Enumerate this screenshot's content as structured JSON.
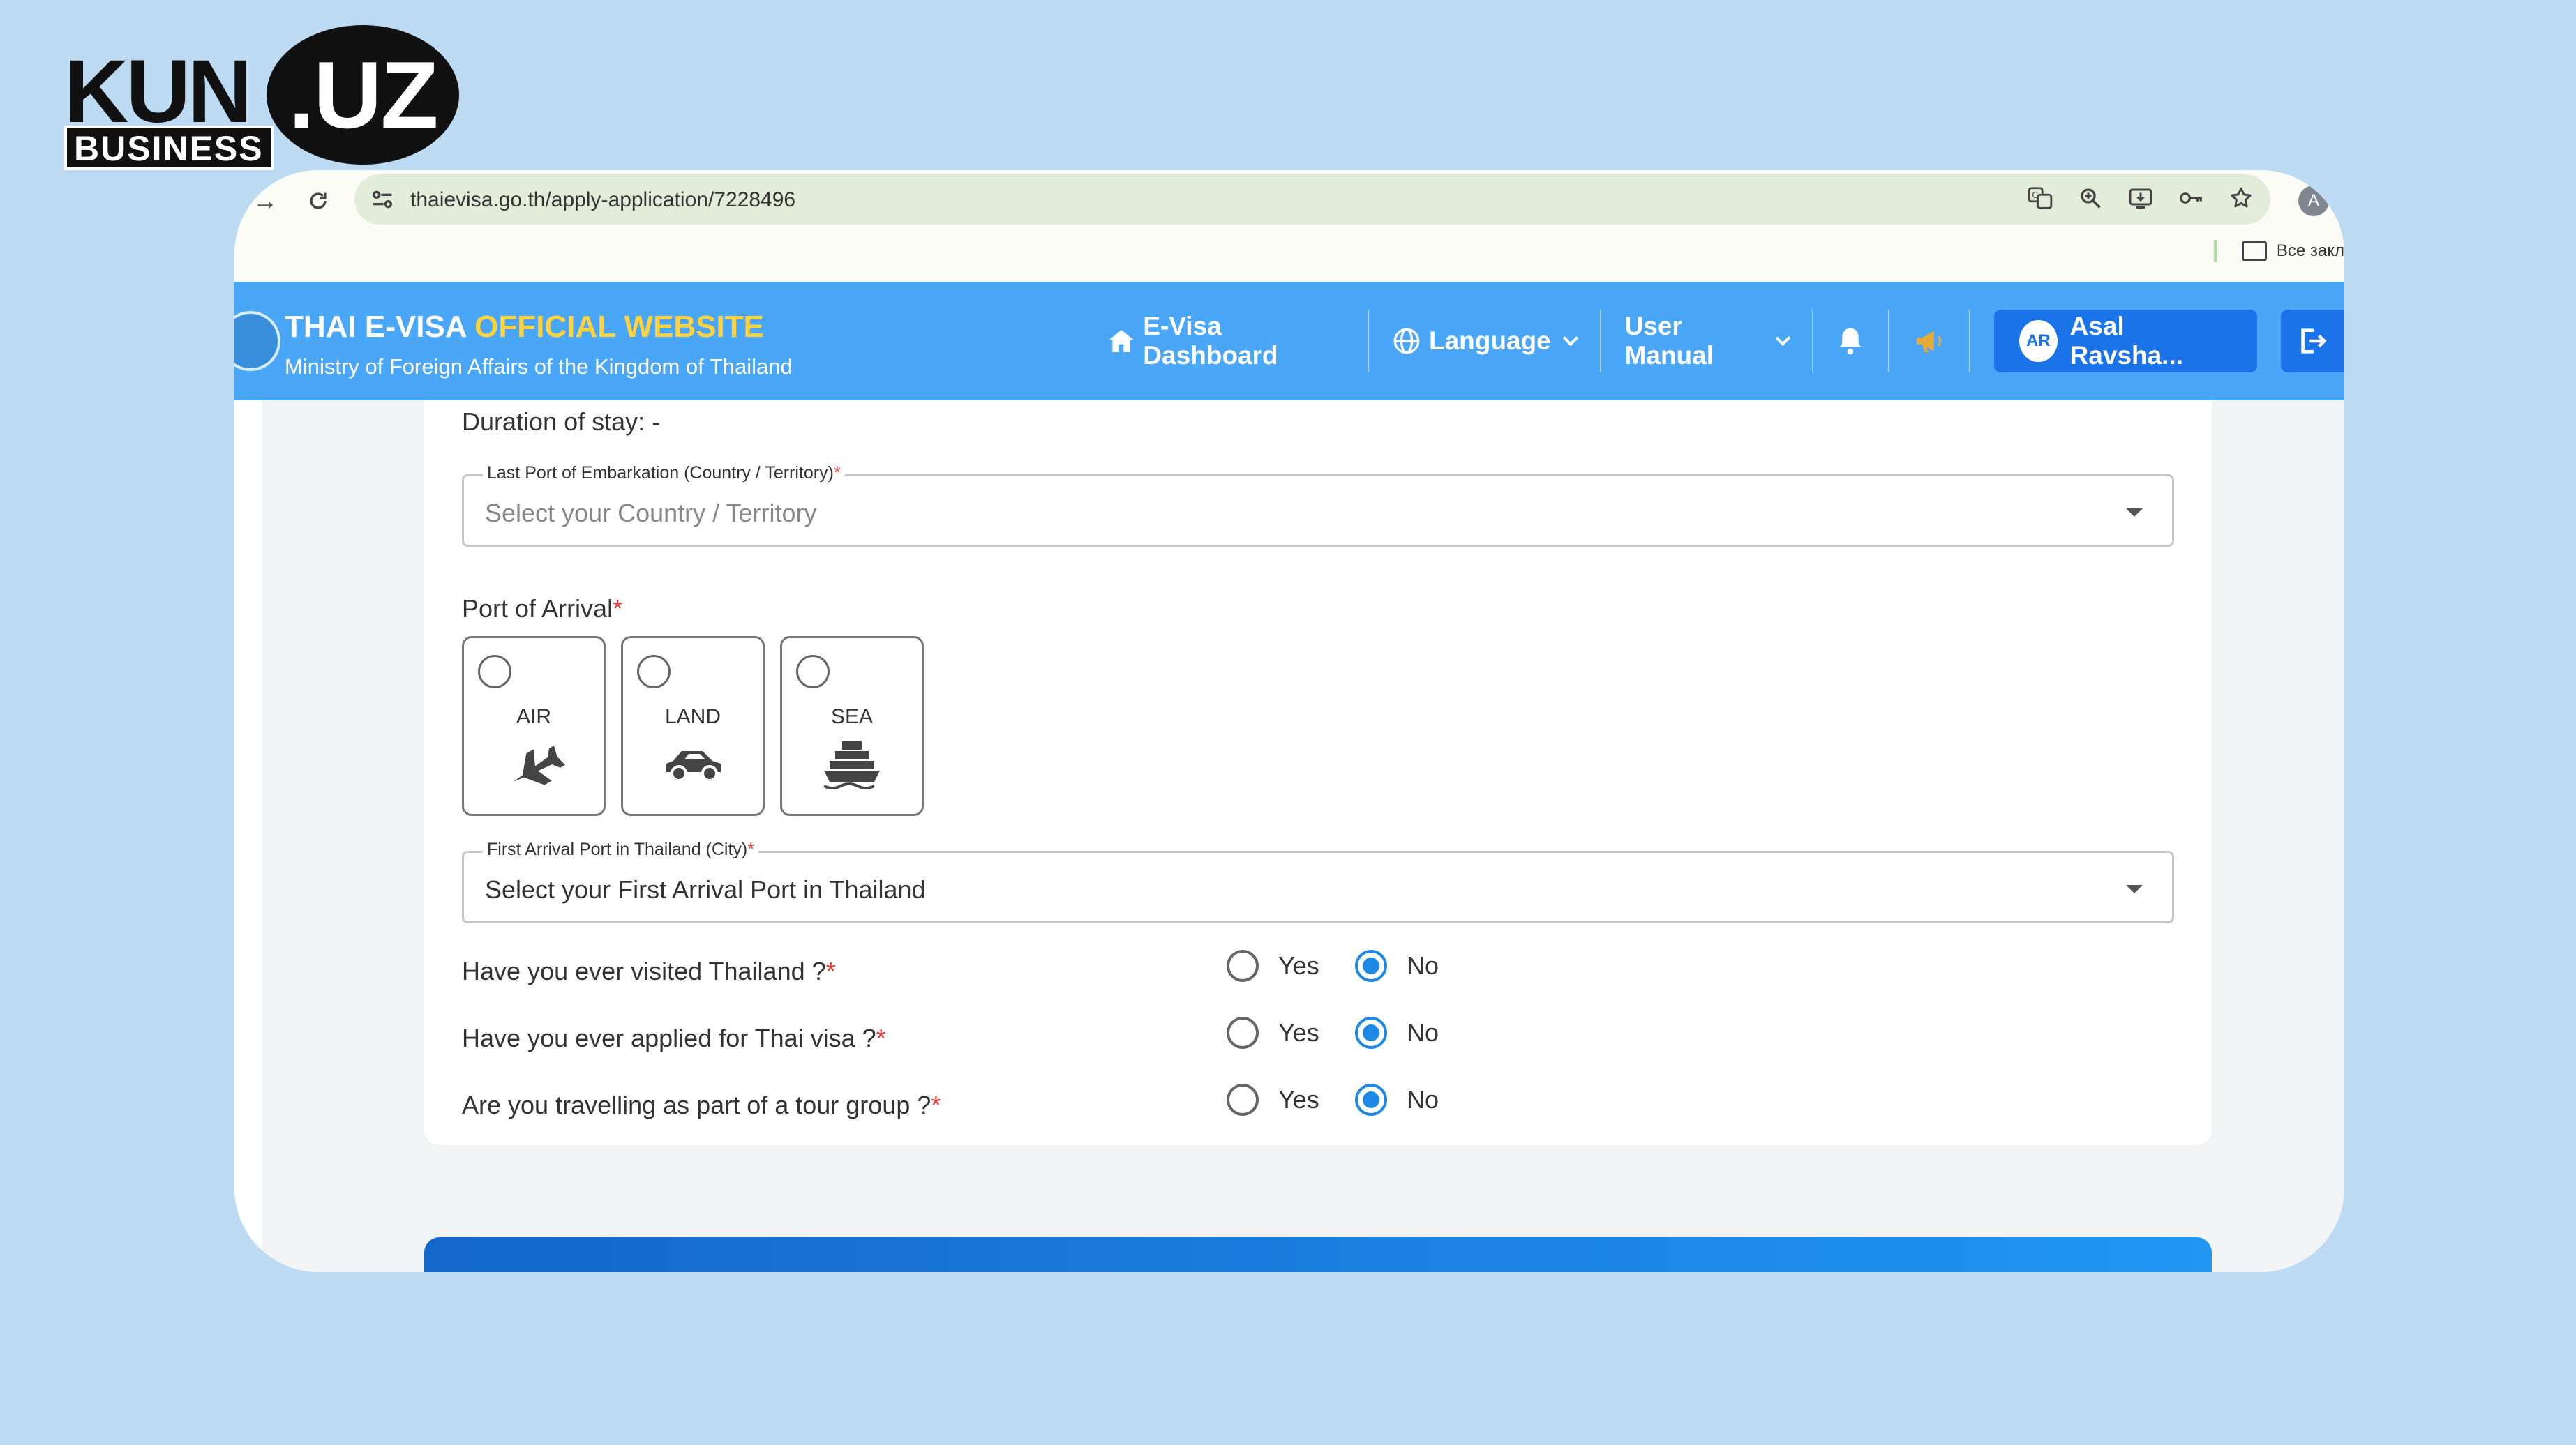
{
  "logo": {
    "kun": "KUN",
    "uz": ".UZ",
    "business": "BUSINESS"
  },
  "browser": {
    "url": "thaievisa.go.th/apply-application/7228496",
    "bookmark_label": "Все закл",
    "profile_initial": "A"
  },
  "site": {
    "title_main": "THAI E-VISA ",
    "title_accent": "OFFICIAL WEBSITE",
    "subtitle": "Ministry of Foreign Affairs of the Kingdom of Thailand",
    "nav": {
      "dashboard": "E-Visa Dashboard",
      "language": "Language",
      "manual": "User Manual",
      "user_initials": "AR",
      "user_name": "Asal Ravsha..."
    },
    "colors": {
      "header": "#4aa6f7",
      "accent": "#ffd33d",
      "primary": "#1a73e8",
      "radio_checked": "#1e88e5",
      "required": "#e53935"
    }
  },
  "form": {
    "duration": "Duration of stay: -",
    "embarkation": {
      "label": "Last Port of Embarkation (Country / Territory)",
      "required": "*",
      "placeholder": "Select your Country / Territory"
    },
    "port_of_arrival": {
      "label": "Port of Arrival",
      "required": "*",
      "options": [
        {
          "label": "AIR",
          "icon": "airplane-icon",
          "selected": false
        },
        {
          "label": "LAND",
          "icon": "car-icon",
          "selected": false
        },
        {
          "label": "SEA",
          "icon": "ship-icon",
          "selected": false
        }
      ]
    },
    "first_arrival_port": {
      "label": "First Arrival Port in Thailand (City)",
      "required": "*",
      "value": "Select your First Arrival Port in Thailand"
    },
    "questions": [
      {
        "text": "Have you ever visited Thailand ?",
        "required": "*",
        "yes": "Yes",
        "no": "No",
        "answer": "No"
      },
      {
        "text": "Have you ever applied for Thai visa ?",
        "required": "*",
        "yes": "Yes",
        "no": "No",
        "answer": "No"
      },
      {
        "text": "Are you travelling as part of a tour group ?",
        "required": "*",
        "yes": "Yes",
        "no": "No",
        "answer": "No"
      }
    ]
  }
}
